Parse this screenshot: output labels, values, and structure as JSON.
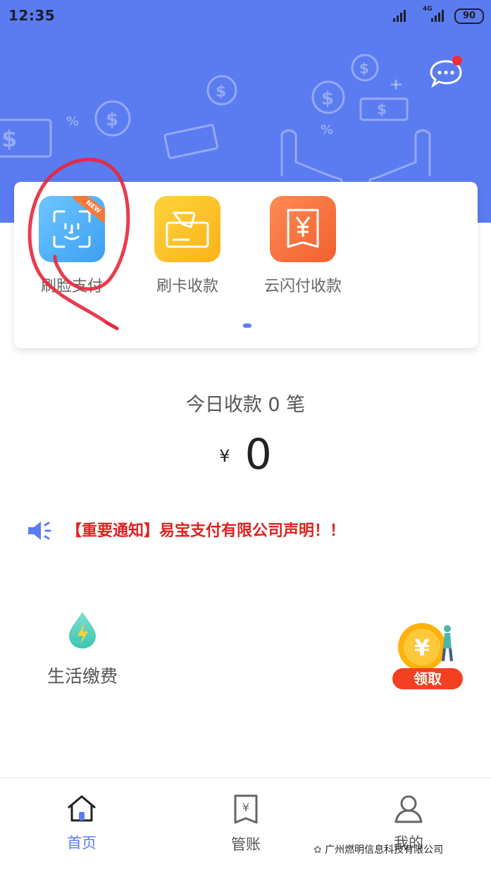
{
  "status_bar": {
    "time": "12:35",
    "network": "4G",
    "battery": "90"
  },
  "quick_actions": [
    {
      "label": "刷脸支付",
      "badge": "NEW"
    },
    {
      "label": "刷卡收款"
    },
    {
      "label": "云闪付收款"
    }
  ],
  "today": {
    "summary": "今日收款 0 笔",
    "currency": "¥",
    "amount": "0"
  },
  "notice": {
    "text": "【重要通知】易宝支付有限公司声明！！"
  },
  "services": {
    "life_label": "生活缴费",
    "promo_label": "领取"
  },
  "nav": {
    "items": [
      {
        "label": "首页",
        "active": true
      },
      {
        "label": "管账",
        "active": false
      },
      {
        "label": "我的",
        "active": false
      }
    ]
  },
  "watermark": "广州燃明信息科技有限公司",
  "colors": {
    "brand_blue": "#5b7cf0",
    "notice_red": "#e02020",
    "annotation_red": "#e8263b"
  }
}
